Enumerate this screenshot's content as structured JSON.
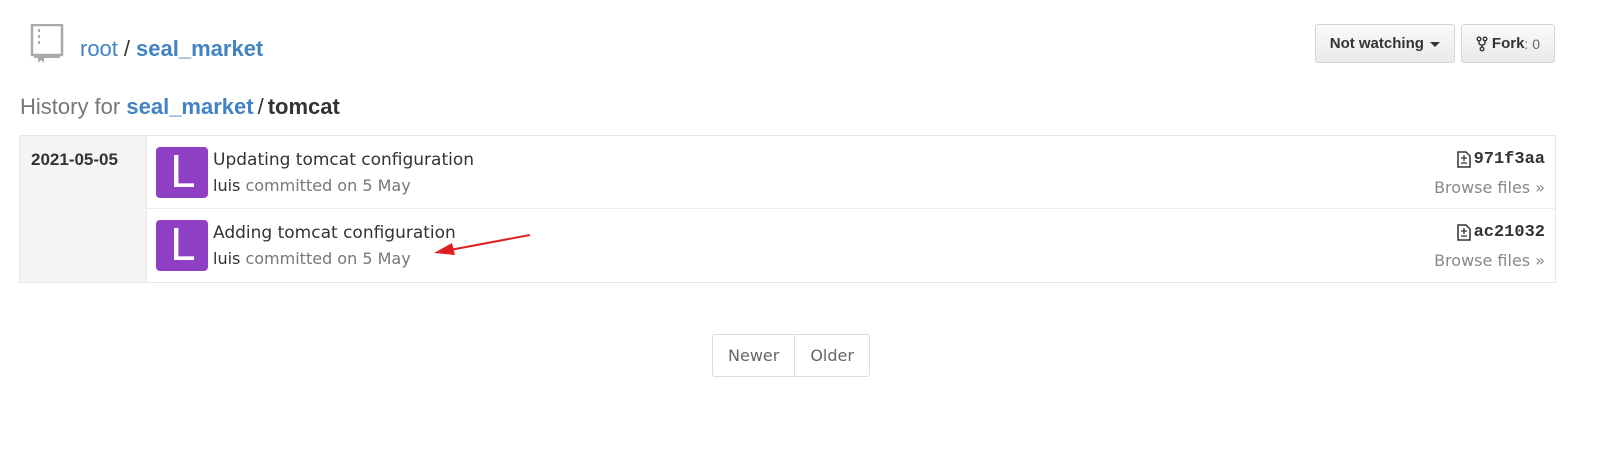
{
  "repo": {
    "owner": "root",
    "separator": "/",
    "name": "seal_market"
  },
  "actions": {
    "watch_label": "Not watching",
    "fork_label": "Fork",
    "fork_count": ": 0"
  },
  "history": {
    "prefix": "History for",
    "repo": "seal_market",
    "separator": "/",
    "path": "tomcat"
  },
  "commit_groups": [
    {
      "date": "2021-05-05",
      "commits": [
        {
          "avatar_letter": "L",
          "message": "Updating tomcat configuration",
          "author": "luis",
          "committed": "committed on 5 May",
          "sha": "971f3aa",
          "browse": "Browse files »"
        },
        {
          "avatar_letter": "L",
          "message": "Adding tomcat configuration",
          "author": "luis",
          "committed": "committed on 5 May",
          "sha": "ac21032",
          "browse": "Browse files »"
        }
      ]
    }
  ],
  "pagination": {
    "newer": "Newer",
    "older": "Older"
  },
  "colors": {
    "link": "#4183c4",
    "avatar": "#8e3fc4",
    "annotation_arrow": "#e02020"
  }
}
